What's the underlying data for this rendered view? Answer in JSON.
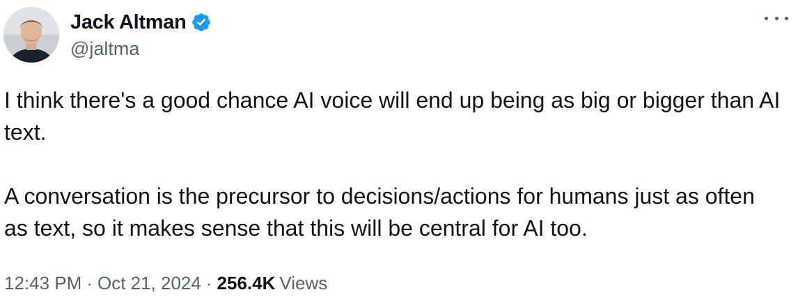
{
  "author": {
    "display_name": "Jack Altman",
    "handle": "@jaltma",
    "verified": true,
    "avatar_icon": "person-avatar"
  },
  "tweet": {
    "paragraphs": [
      "I think there's a good chance AI voice will end up being as big or bigger than AI text.",
      "A conversation is the precursor to decisions/actions for humans just as often as text, so it makes sense that this will be central for AI too."
    ],
    "time": "12:43 PM",
    "separator": "·",
    "date": "Oct 21, 2024",
    "views_count": "256.4K",
    "views_label": "Views"
  },
  "menu": {
    "icon": "more-options-icon"
  },
  "colors": {
    "text_primary": "#0f1419",
    "text_secondary": "#536471",
    "verified_blue": "#1d9bf0"
  }
}
